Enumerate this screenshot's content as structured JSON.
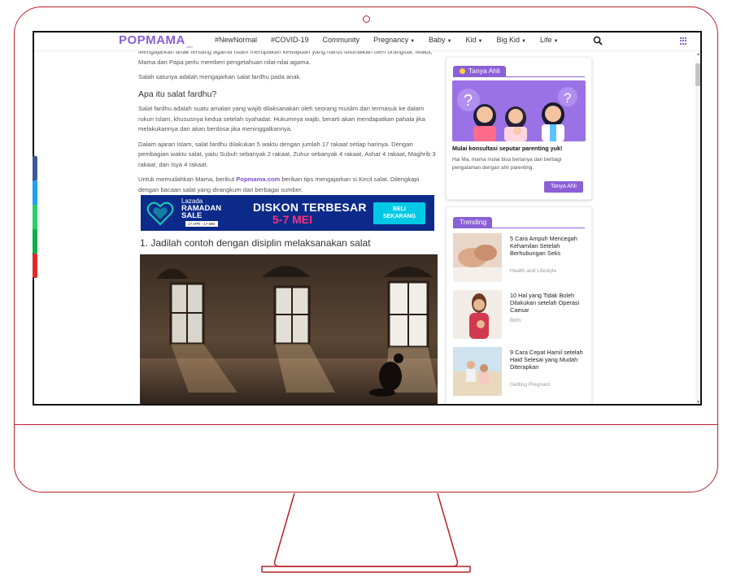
{
  "site": {
    "logo": "POPMAMA",
    "logo_sub": ".com",
    "brand_color": "#8b5fd6"
  },
  "nav": {
    "items": [
      {
        "label": "#NewNormal",
        "dropdown": false
      },
      {
        "label": "#COVID-19",
        "dropdown": false
      },
      {
        "label": "Community",
        "dropdown": false
      },
      {
        "label": "Pregnancy",
        "dropdown": true
      },
      {
        "label": "Baby",
        "dropdown": true
      },
      {
        "label": "Kid",
        "dropdown": true
      },
      {
        "label": "Big Kid",
        "dropdown": true
      },
      {
        "label": "Life",
        "dropdown": true
      }
    ],
    "search_icon": "search-icon",
    "menu_icon": "grid-icon"
  },
  "article": {
    "p_top": "Mengajarkan anak tentang agama Islam merupakan kewajiban yang harus ditunaikan oleh orangtua. Maka, Mama dan Papa perlu memberi pengetahuan nilai-nilai agama.",
    "p_salah": "Salah satunya adalah mengajarkan salat fardhu pada anak.",
    "heading": "Apa itu salat fardhu?",
    "p_def": "Salat fardhu adalah suatu amalan yang wajib dilaksanakan oleh seorang muslim dan termasuk ke dalam rukun Islam, khususnya kedua setelah syahadat. Hukumnya wajib, berarti akan mendapatkan pahala jika melakukannya dan akan berdosa jika meninggalkannya.",
    "p_ajaran": "Dalam ajaran Islam, salat fardhu dilakukan 5 waktu dengan jumlah 17 rakaat setiap harinya. Dengan pembagian waktu salat, yaitu Subuh sebanyak 2 rakaat, Zuhur sebanyak 4 rakaat, Ashar 4 rakaat, Maghrib 3 rakaat, dan Isya 4 rakaat.",
    "p_tips_before": "Untuk memudahkan Mama, berikut ",
    "p_tips_link": "Popmama.com",
    "p_tips_after": " berikan tips mengajarkan si Kecil salat. Dilengkapi dengan bacaan salat yang dirangkum dari berbagai sumber.",
    "subheading": "1. Jadilah contoh dengan disiplin melaksanakan salat"
  },
  "banner": {
    "brand": "Lazada",
    "line1": "RAMADAN",
    "line2": "SALE",
    "dates": "17 APR - 17 MEI",
    "headline": "DISKON TERBESAR",
    "sub": "5-7 MEI",
    "cta_line1": "BELI",
    "cta_line2": "SEKARANG"
  },
  "sidebar": {
    "ask": {
      "tag": "Tanya Ahli",
      "title": "Mulai konsultasi seputar parenting yuk!",
      "desc": "Hai Ma, mama mulai bisa bertanya dan berbagi pengalaman dengan ahli parenting.",
      "button": "Tanya Ahli"
    },
    "trending": {
      "tag": "Trending",
      "items": [
        {
          "title": "5 Cara Ampuh Mencegah Kehamilan Setelah Berhubungan Seks",
          "category": "Health and Lifestyle"
        },
        {
          "title": "10 Hal yang Tidak Boleh Dilakukan setelah Operasi Caesar",
          "category": "Birth"
        },
        {
          "title": "9 Cara Cepat Hamil setelah Haid Selesai yang Mudah Diterapkan",
          "category": "Getting Pregnant"
        }
      ]
    }
  },
  "colors": {
    "frame": "#b8202a",
    "accent": "#8b5fd6",
    "link": "#7c4fd0"
  }
}
